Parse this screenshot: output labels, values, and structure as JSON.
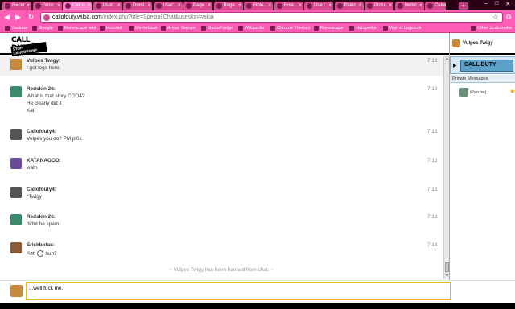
{
  "browser": {
    "tabs": [
      {
        "label": "Recer"
      },
      {
        "label": "Grinc"
      },
      {
        "label": "Call o",
        "active": true
      },
      {
        "label": "User:"
      },
      {
        "label": "Domi"
      },
      {
        "label": "User:"
      },
      {
        "label": "Page"
      },
      {
        "label": "Rage"
      },
      {
        "label": "Role"
      },
      {
        "label": "Role"
      },
      {
        "label": "User:"
      },
      {
        "label": "Planc"
      },
      {
        "label": "Pictu"
      },
      {
        "label": "Hello!"
      },
      {
        "label": "Cerer"
      }
    ],
    "url_host": "callofduty.wikia.com",
    "url_path": "/index.php?title=Special:Chat&useskin=wikia",
    "bookmarks": [
      {
        "label": "Youtube"
      },
      {
        "label": "Google"
      },
      {
        "label": "Runescape wiki"
      },
      {
        "label": "Hotmail"
      },
      {
        "label": "Memebase"
      },
      {
        "label": "Armor Games"
      },
      {
        "label": "GameFudge"
      },
      {
        "label": "Wikipedia"
      },
      {
        "label": "Chrome Themes"
      },
      {
        "label": "Runescape"
      },
      {
        "label": "Halopedia"
      },
      {
        "label": "War of Legends"
      }
    ],
    "other_bookmarks": "Other bookmarks"
  },
  "chat": {
    "logo_text": "CALL DUTY",
    "logo_banner": "STOP CENSORSHIP",
    "messages": [
      {
        "name": "Vulpes Twigy:",
        "lines": [
          "I got logs here."
        ],
        "time": "7:13",
        "alt": true
      },
      {
        "name": "Redskin 26:",
        "lines": [
          "What is that story COD4?",
          "He clearly did it",
          "Kat"
        ],
        "time": "7:13",
        "alt": false
      },
      {
        "name": "Callofduty4:",
        "lines": [
          "Vulpes you do? PM pl0x"
        ],
        "time": "7:13",
        "alt": false
      },
      {
        "name": "KATANAGOD:",
        "lines": [
          "wath"
        ],
        "time": "7:13",
        "alt": false
      },
      {
        "name": "Callofduty4:",
        "lines": [
          "*Twigy"
        ],
        "time": "7:13",
        "alt": false
      },
      {
        "name": "Redskin 26:",
        "lines": [
          "didnt he spam"
        ],
        "time": "7:13",
        "alt": false
      },
      {
        "name": "Erickbotas:",
        "lines": [
          "Kat:",
          "huh?"
        ],
        "time": "7:13",
        "alt": false
      }
    ],
    "system_message": "~ Vulpes Twigy has been banned from chat. ~",
    "input_value": "...well fuck me."
  },
  "rail": {
    "self_name": "Vulpes Twigy",
    "room_logo": "CALL DUTY",
    "private_messages_label": "Private Messages",
    "pm_users": [
      {
        "name": "iPanzerj"
      }
    ]
  }
}
